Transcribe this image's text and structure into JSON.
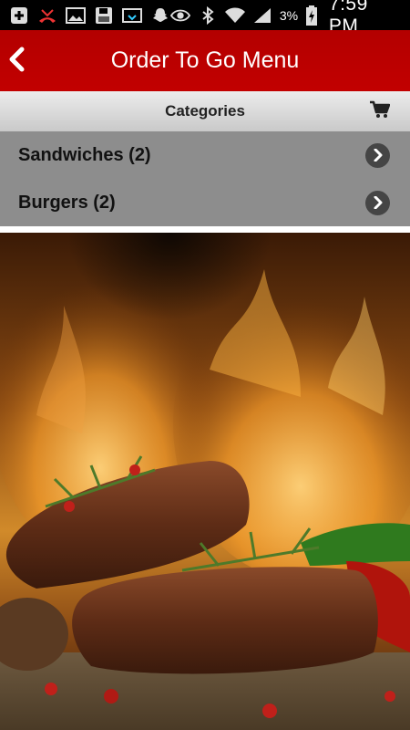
{
  "status_bar": {
    "battery_percent": "3%",
    "time": "7:59 PM"
  },
  "header": {
    "title": "Order To Go Menu"
  },
  "categories_bar": {
    "title": "Categories"
  },
  "categories": [
    {
      "label": "Sandwiches (2)"
    },
    {
      "label": "Burgers (2)"
    }
  ],
  "colors": {
    "header_red": "#c20000",
    "list_gray": "#8d8d8d",
    "chevron_bg": "#454545"
  },
  "icons": [
    "plus-box-icon",
    "missed-call-icon",
    "gallery-icon",
    "save-icon",
    "cast-icon",
    "snapchat-icon",
    "eye-icon",
    "bluetooth-icon",
    "wifi-icon",
    "signal-icon",
    "battery-charging-icon",
    "back-chevron-icon",
    "cart-icon",
    "chevron-right-icon"
  ]
}
